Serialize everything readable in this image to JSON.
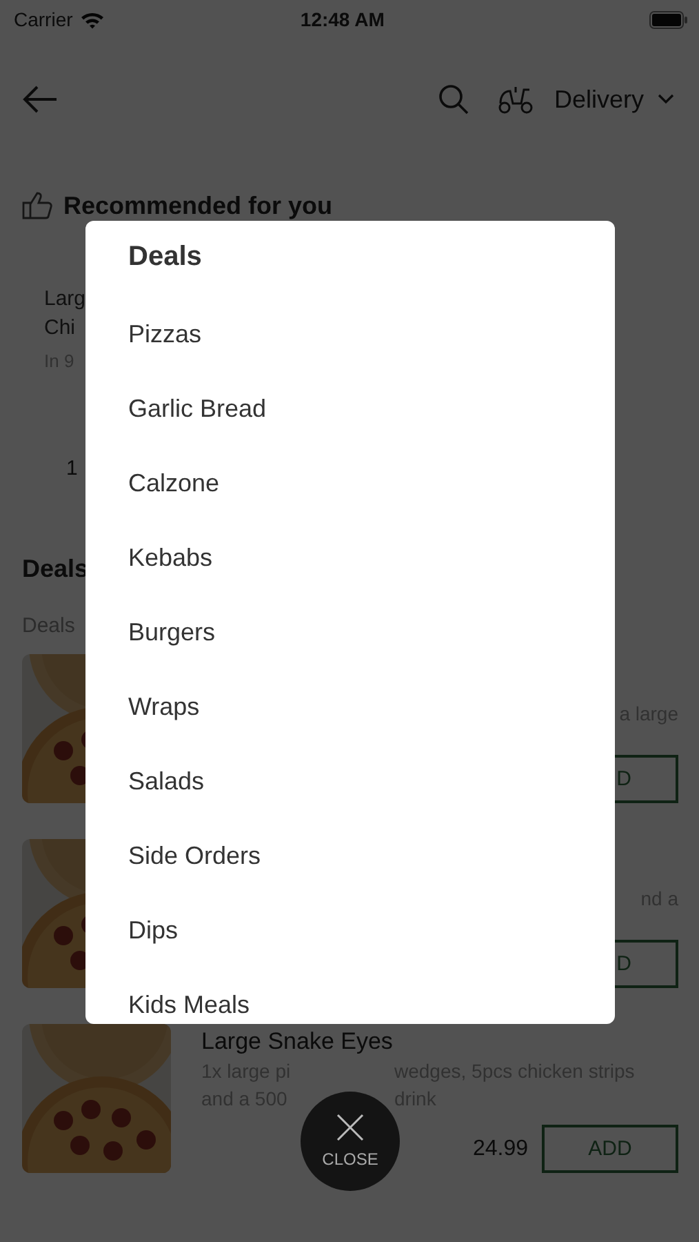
{
  "status_bar": {
    "carrier": "Carrier",
    "time": "12:48 AM"
  },
  "header": {
    "order_mode": "Delivery"
  },
  "recommended": {
    "title": "Recommended for you",
    "name_fragments": [
      "Larg",
      "Chi"
    ],
    "eta_fragment": "In 9",
    "price_fragment": "1"
  },
  "section": {
    "title_fragment": "Deals",
    "subtitle_fragment": "Deals"
  },
  "products": [
    {
      "kind": "partial",
      "desc_fragment": "a large",
      "button_fragment": "D"
    },
    {
      "kind": "partial",
      "desc_fragment": "nd a",
      "button_fragment": "D"
    },
    {
      "kind": "full",
      "name": "Large Snake Eyes",
      "desc_lines": [
        [
          "1x large pi",
          "wedges, 5pcs chicken strips"
        ],
        [
          "and a 500",
          "drink"
        ]
      ],
      "price": "24.99",
      "button": "ADD"
    }
  ],
  "menu": {
    "title": "Deals",
    "items": [
      "Pizzas",
      "Garlic Bread",
      "Calzone",
      "Kebabs",
      "Burgers",
      "Wraps",
      "Salads",
      "Side Orders",
      "Dips",
      "Kids Meals"
    ]
  },
  "close_button": {
    "label": "CLOSE"
  }
}
